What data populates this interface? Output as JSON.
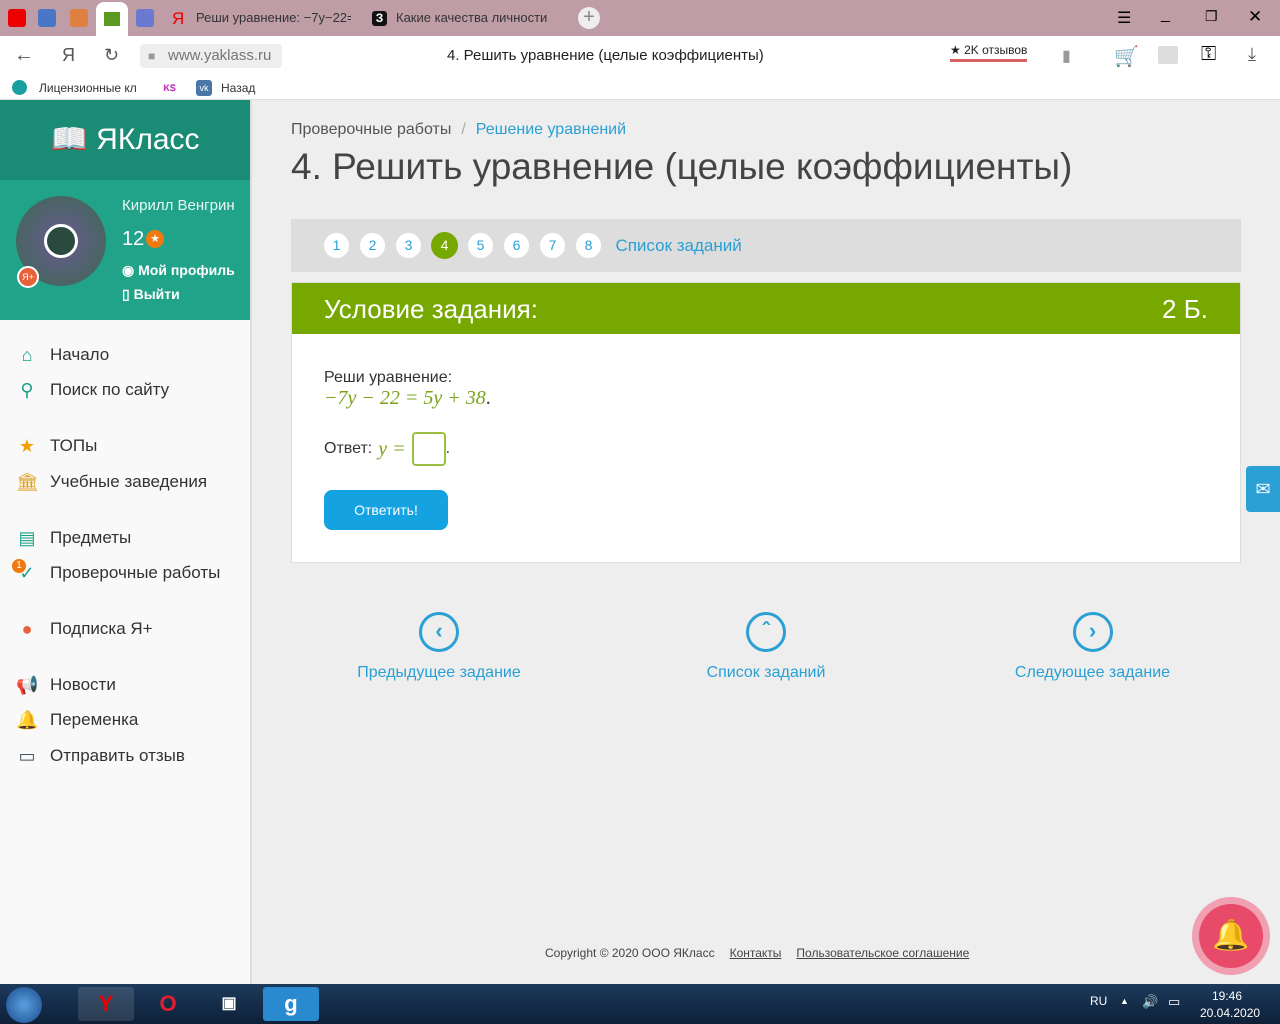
{
  "browser": {
    "tabs": [
      {
        "label": "Реши уравнение: −7y−22="
      },
      {
        "label": "Какие качества личности"
      }
    ],
    "url": "www.yaklass.ru",
    "page_title": "4. Решить уравнение (целые коэффициенты)",
    "reviews": "★ 2K отзывов",
    "bookmarks": [
      "Лицензионные кл",
      "Назад"
    ]
  },
  "sidebar": {
    "logo": "ЯКласс",
    "user": "Кирилл Венгрин",
    "points": "12",
    "profile": "Мой профиль",
    "logout": "Выйти",
    "items": [
      {
        "label": "Начало",
        "icon": "home-icon"
      },
      {
        "label": "Поиск по сайту",
        "icon": "search-icon"
      },
      {
        "label": "ТОПы",
        "icon": "star-icon"
      },
      {
        "label": "Учебные заведения",
        "icon": "building-icon"
      },
      {
        "label": "Предметы",
        "icon": "book-icon"
      },
      {
        "label": "Проверочные работы",
        "icon": "check-icon",
        "badge": "1"
      },
      {
        "label": "Подписка Я+",
        "icon": "yaplus-icon"
      },
      {
        "label": "Новости",
        "icon": "megaphone-icon"
      },
      {
        "label": "Переменка",
        "icon": "bell-icon"
      },
      {
        "label": "Отправить отзыв",
        "icon": "feedback-icon"
      }
    ]
  },
  "breadcrumb": [
    "Проверочные работы",
    "Решение уравнений"
  ],
  "title": "4. Решить уравнение (целые коэффициенты)",
  "pages": [
    "1",
    "2",
    "3",
    "4",
    "5",
    "6",
    "7",
    "8"
  ],
  "current_page": "4",
  "task_list": "Список заданий",
  "task": {
    "header": "Условие задания:",
    "score": "2 Б.",
    "prompt": "Реши уравнение:",
    "equation": "−7y − 22 = 5y + 38",
    "answer_label": "Ответ:",
    "answer_var": "y =",
    "answer_value": "",
    "submit": "Ответить!"
  },
  "nav": {
    "prev": "Предыдущее задание",
    "list": "Список заданий",
    "next": "Следующее задание"
  },
  "footer": {
    "copyright": "Copyright © 2020 ООО ЯКласс",
    "contacts": "Контакты",
    "agreement": "Пользовательское соглашение"
  },
  "taskbar": {
    "lang": "RU",
    "time": "19:46",
    "date": "20.04.2020"
  },
  "colors": {
    "green": "#77a800",
    "teal": "#21a38a",
    "blue": "#2aa0d4"
  }
}
